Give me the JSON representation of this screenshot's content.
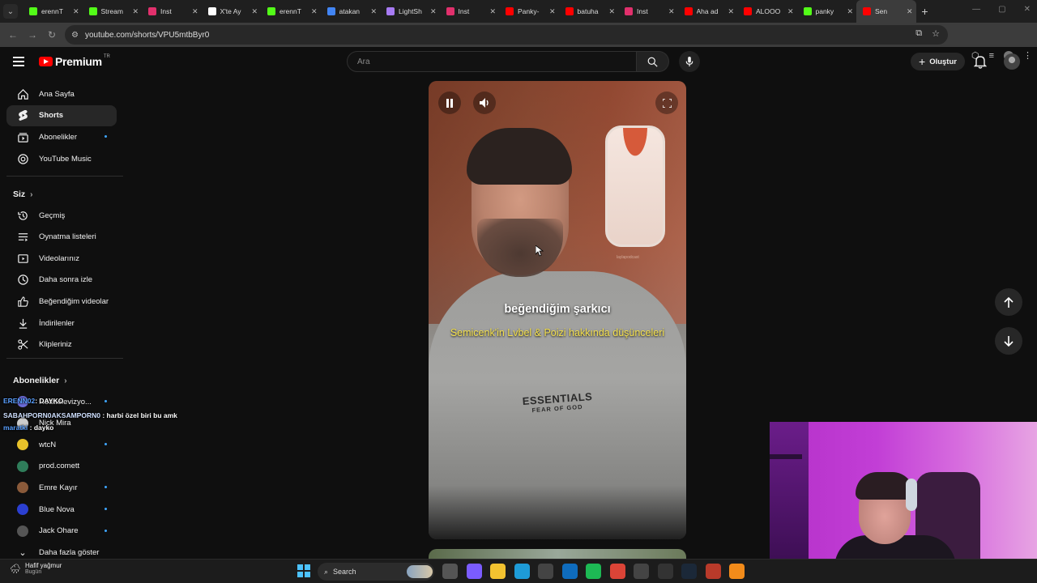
{
  "browser": {
    "tabs": [
      {
        "label": "erennT",
        "icon": "kick",
        "color": "#53fc18"
      },
      {
        "label": "Stream",
        "icon": "kick",
        "color": "#53fc18"
      },
      {
        "label": "Inst",
        "icon": "instagram",
        "color": "#e1306c"
      },
      {
        "label": "X'te Ay",
        "icon": "x",
        "color": "#ffffff"
      },
      {
        "label": "erennT",
        "icon": "kick",
        "color": "#53fc18"
      },
      {
        "label": "atakan",
        "icon": "google",
        "color": "#4285f4"
      },
      {
        "label": "LightSh",
        "icon": "lightshot",
        "color": "#a77bf3"
      },
      {
        "label": "Inst",
        "icon": "instagram",
        "color": "#e1306c"
      },
      {
        "label": "Panky-",
        "icon": "youtube",
        "color": "#ff0000"
      },
      {
        "label": "batuha",
        "icon": "youtube",
        "color": "#ff0000"
      },
      {
        "label": "Inst",
        "icon": "instagram",
        "color": "#e1306c"
      },
      {
        "label": "Aha ad",
        "icon": "youtube",
        "color": "#ff0000"
      },
      {
        "label": "ALOOO",
        "icon": "youtube",
        "color": "#ff0000"
      },
      {
        "label": "panky",
        "icon": "kick",
        "color": "#53fc18"
      },
      {
        "label": "Sen",
        "icon": "youtube",
        "color": "#ff0000",
        "active": true
      }
    ],
    "url": "youtube.com/shorts/VPU5mtbByr0"
  },
  "header": {
    "logo_text": "Premium",
    "country": "TR",
    "search_placeholder": "Ara",
    "create_label": "Oluştur"
  },
  "sidebar": {
    "main": [
      {
        "label": "Ana Sayfa",
        "icon": "home-icon"
      },
      {
        "label": "Shorts",
        "icon": "shorts-icon",
        "active": true
      },
      {
        "label": "Abonelikler",
        "icon": "subscriptions-icon",
        "dot": true
      },
      {
        "label": "YouTube Music",
        "icon": "music-icon"
      }
    ],
    "you_title": "Siz",
    "you": [
      {
        "label": "Geçmiş",
        "icon": "history-icon"
      },
      {
        "label": "Oynatma listeleri",
        "icon": "playlist-icon"
      },
      {
        "label": "Videolarınız",
        "icon": "your-videos-icon"
      },
      {
        "label": "Daha sonra izle",
        "icon": "watch-later-icon"
      },
      {
        "label": "Beğendiğim videolar",
        "icon": "like-icon"
      },
      {
        "label": "İndirilenler",
        "icon": "download-icon"
      },
      {
        "label": "Klipleriniz",
        "icon": "clips-icon"
      }
    ],
    "subs_title": "Abonelikler",
    "channels": [
      {
        "label": "Rotatelevizyo...",
        "dot": true,
        "color": "#6b6bd6"
      },
      {
        "label": "Nick Mira",
        "dot": false,
        "color": "#cccccc"
      },
      {
        "label": "wtcN",
        "dot": true,
        "color": "#e8c22a"
      },
      {
        "label": "prod.comett",
        "dot": false,
        "color": "#2f7d5a"
      },
      {
        "label": "Emre Kayır",
        "dot": true,
        "color": "#8a5a3a"
      },
      {
        "label": "Blue Nova",
        "dot": true,
        "color": "#2b3fd1"
      },
      {
        "label": "Jack Ohare",
        "dot": true,
        "color": "#555555"
      }
    ],
    "show_more": "Daha fazla göster"
  },
  "chat": [
    {
      "user": "ERENN02",
      "msg": "DAYKO"
    },
    {
      "user": "SABAHPORN0AKSAMPORN0",
      "msg": "harbi özel biri bu amk"
    },
    {
      "user": "maratki",
      "msg": "dayko"
    }
  ],
  "video": {
    "caption_main": "beğendiğim şarkıcı",
    "caption_sub": "Semicenk'in Lvbel & Poizi hakkında düşünceleri",
    "shirt_brand": "ESSENTIALS",
    "shirt_sub": "FEAR OF GOD",
    "watermark": "laylapodcast"
  },
  "taskbar": {
    "weather_title": "Hafif yağmur",
    "weather_sub": "Bugün",
    "search_label": "Search",
    "apps": [
      {
        "name": "task-view",
        "color": "#555"
      },
      {
        "name": "copilot",
        "color": "#7b5cff"
      },
      {
        "name": "file-explorer",
        "color": "#f2c230"
      },
      {
        "name": "edge",
        "color": "#1e9bd7"
      },
      {
        "name": "store",
        "color": "#444"
      },
      {
        "name": "outlook",
        "color": "#0f6cbd"
      },
      {
        "name": "spotify",
        "color": "#1db954"
      },
      {
        "name": "chrome",
        "color": "#db4437"
      },
      {
        "name": "media-player",
        "color": "#444"
      },
      {
        "name": "obs",
        "color": "#333"
      },
      {
        "name": "steam",
        "color": "#1b2838"
      },
      {
        "name": "nova",
        "color": "#b83a2a"
      },
      {
        "name": "fl-studio",
        "color": "#f28b1a"
      }
    ]
  }
}
